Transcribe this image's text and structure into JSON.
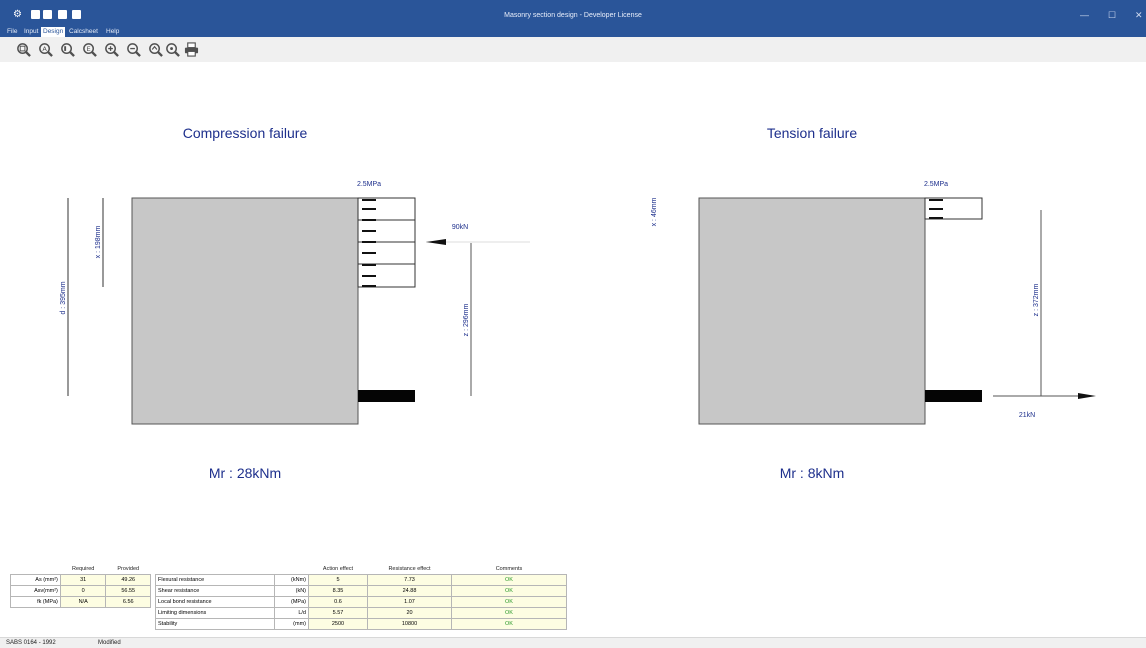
{
  "window": {
    "title": "Masonry section design - Developer License",
    "controls": {
      "minimize": "—",
      "maximize": "☐",
      "close": "✕"
    }
  },
  "menu": {
    "items": [
      "File",
      "Input",
      "Design",
      "Calcsheet",
      "Help"
    ],
    "active": "Design"
  },
  "toolbar": {
    "buttons": [
      "zoom-window",
      "zoom-all",
      "zoom-left",
      "zoom-extents",
      "zoom-in",
      "zoom-out",
      "zoom-previous",
      "pan",
      "print"
    ]
  },
  "diagrams": {
    "compression": {
      "title": "Compression failure",
      "stress": "2.5MPa",
      "force": "90kN",
      "x": "x : 198mm",
      "d": "d : 395mm",
      "z": "z : 296mm",
      "moment": "Mr : 28kNm"
    },
    "tension": {
      "title": "Tension failure",
      "stress": "2.5MPa",
      "force": "21kN",
      "x": "x : 46mm",
      "z": "z : 372mm",
      "moment": "Mr : 8kNm"
    }
  },
  "reinforcement_table": {
    "headers": [
      "",
      "Required",
      "Provided"
    ],
    "rows": [
      {
        "label": "As (mm²)",
        "required": "31",
        "provided": "49.26"
      },
      {
        "label": "Asv(mm²)",
        "required": "0",
        "provided": "56.55"
      },
      {
        "label": "fk (MPa)",
        "required": "N/A",
        "provided": "6.56"
      }
    ]
  },
  "checks_table": {
    "headers": [
      "",
      "",
      "Action effect",
      "Resistance effect",
      "Comments"
    ],
    "rows": [
      {
        "label": "Flexural resistance",
        "unit": "(kNm)",
        "action": "5",
        "resistance": "7.73",
        "comment": "OK"
      },
      {
        "label": "Shear resistance",
        "unit": "(kN)",
        "action": "8.35",
        "resistance": "24.88",
        "comment": "OK"
      },
      {
        "label": "Local bond resistance",
        "unit": "(MPa)",
        "action": "0.6",
        "resistance": "1.07",
        "comment": "OK"
      },
      {
        "label": "Limiting dimensions",
        "unit": "L/d",
        "action": "5.57",
        "resistance": "20",
        "comment": "OK"
      },
      {
        "label": "Stability",
        "unit": "(mm)",
        "action": "2500",
        "resistance": "10800",
        "comment": "OK"
      }
    ]
  },
  "status": {
    "code": "SABS 0164 - 1992",
    "state": "Modified"
  },
  "colors": {
    "titlebar": "#2a5599",
    "diagram_text": "#1d2f8c",
    "ok": "#2a9a2a",
    "section_fill": "#c7c7c7"
  }
}
